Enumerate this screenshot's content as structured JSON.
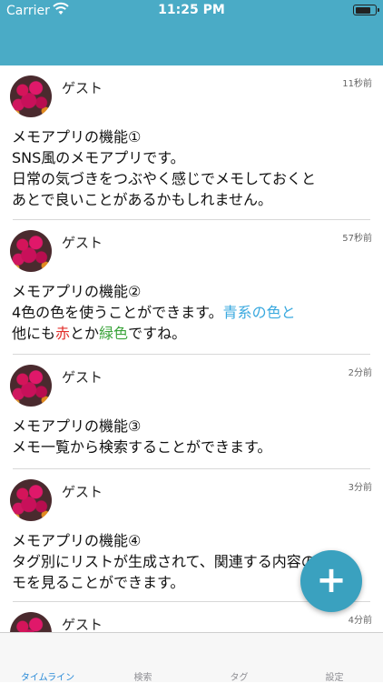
{
  "status_bar": {
    "carrier": "Carrier",
    "time": "11:25 PM",
    "battery_level": 0.8
  },
  "posts": [
    {
      "author": "ゲスト",
      "time": "11秒前",
      "lines": [
        [
          {
            "text": "メモアプリの機能①"
          }
        ],
        [
          {
            "text": "SNS風のメモアプリです。"
          }
        ],
        [
          {
            "text": "日常の気づきをつぶやく感じでメモしておくと"
          }
        ],
        [
          {
            "text": "あとで良いことがあるかもしれません。"
          }
        ]
      ]
    },
    {
      "author": "ゲスト",
      "time": "57秒前",
      "lines": [
        [
          {
            "text": "メモアプリの機能②"
          }
        ],
        [
          {
            "text": "4色の色を使うことができます。"
          },
          {
            "text": "青系の色と",
            "color": "#3aa9df"
          }
        ],
        [
          {
            "text": "他にも"
          },
          {
            "text": "赤",
            "color": "#e2302c"
          },
          {
            "text": "とか"
          },
          {
            "text": "緑色",
            "color": "#3ba43b"
          },
          {
            "text": "ですね。"
          }
        ]
      ]
    },
    {
      "author": "ゲスト",
      "time": "2分前",
      "lines": [
        [
          {
            "text": "メモアプリの機能③"
          }
        ],
        [
          {
            "text": "メモ一覧から検索することができます。"
          }
        ]
      ]
    },
    {
      "author": "ゲスト",
      "time": "3分前",
      "lines": [
        [
          {
            "text": "メモアプリの機能④"
          }
        ],
        [
          {
            "text": "タグ別にリストが生成されて、関連する内容のメ"
          }
        ],
        [
          {
            "text": "モを見ることができます。"
          }
        ]
      ]
    },
    {
      "author": "ゲスト",
      "time": "4分前",
      "lines": []
    }
  ],
  "fab": {
    "label": "+"
  },
  "tabs": [
    {
      "label": "タイムライン",
      "active": true
    },
    {
      "label": "検索",
      "active": false
    },
    {
      "label": "タグ",
      "active": false
    },
    {
      "label": "設定",
      "active": false
    }
  ],
  "colors": {
    "header": "#4aabc6",
    "fab": "#3aa1bf",
    "active_tab": "#2a8bd8"
  }
}
